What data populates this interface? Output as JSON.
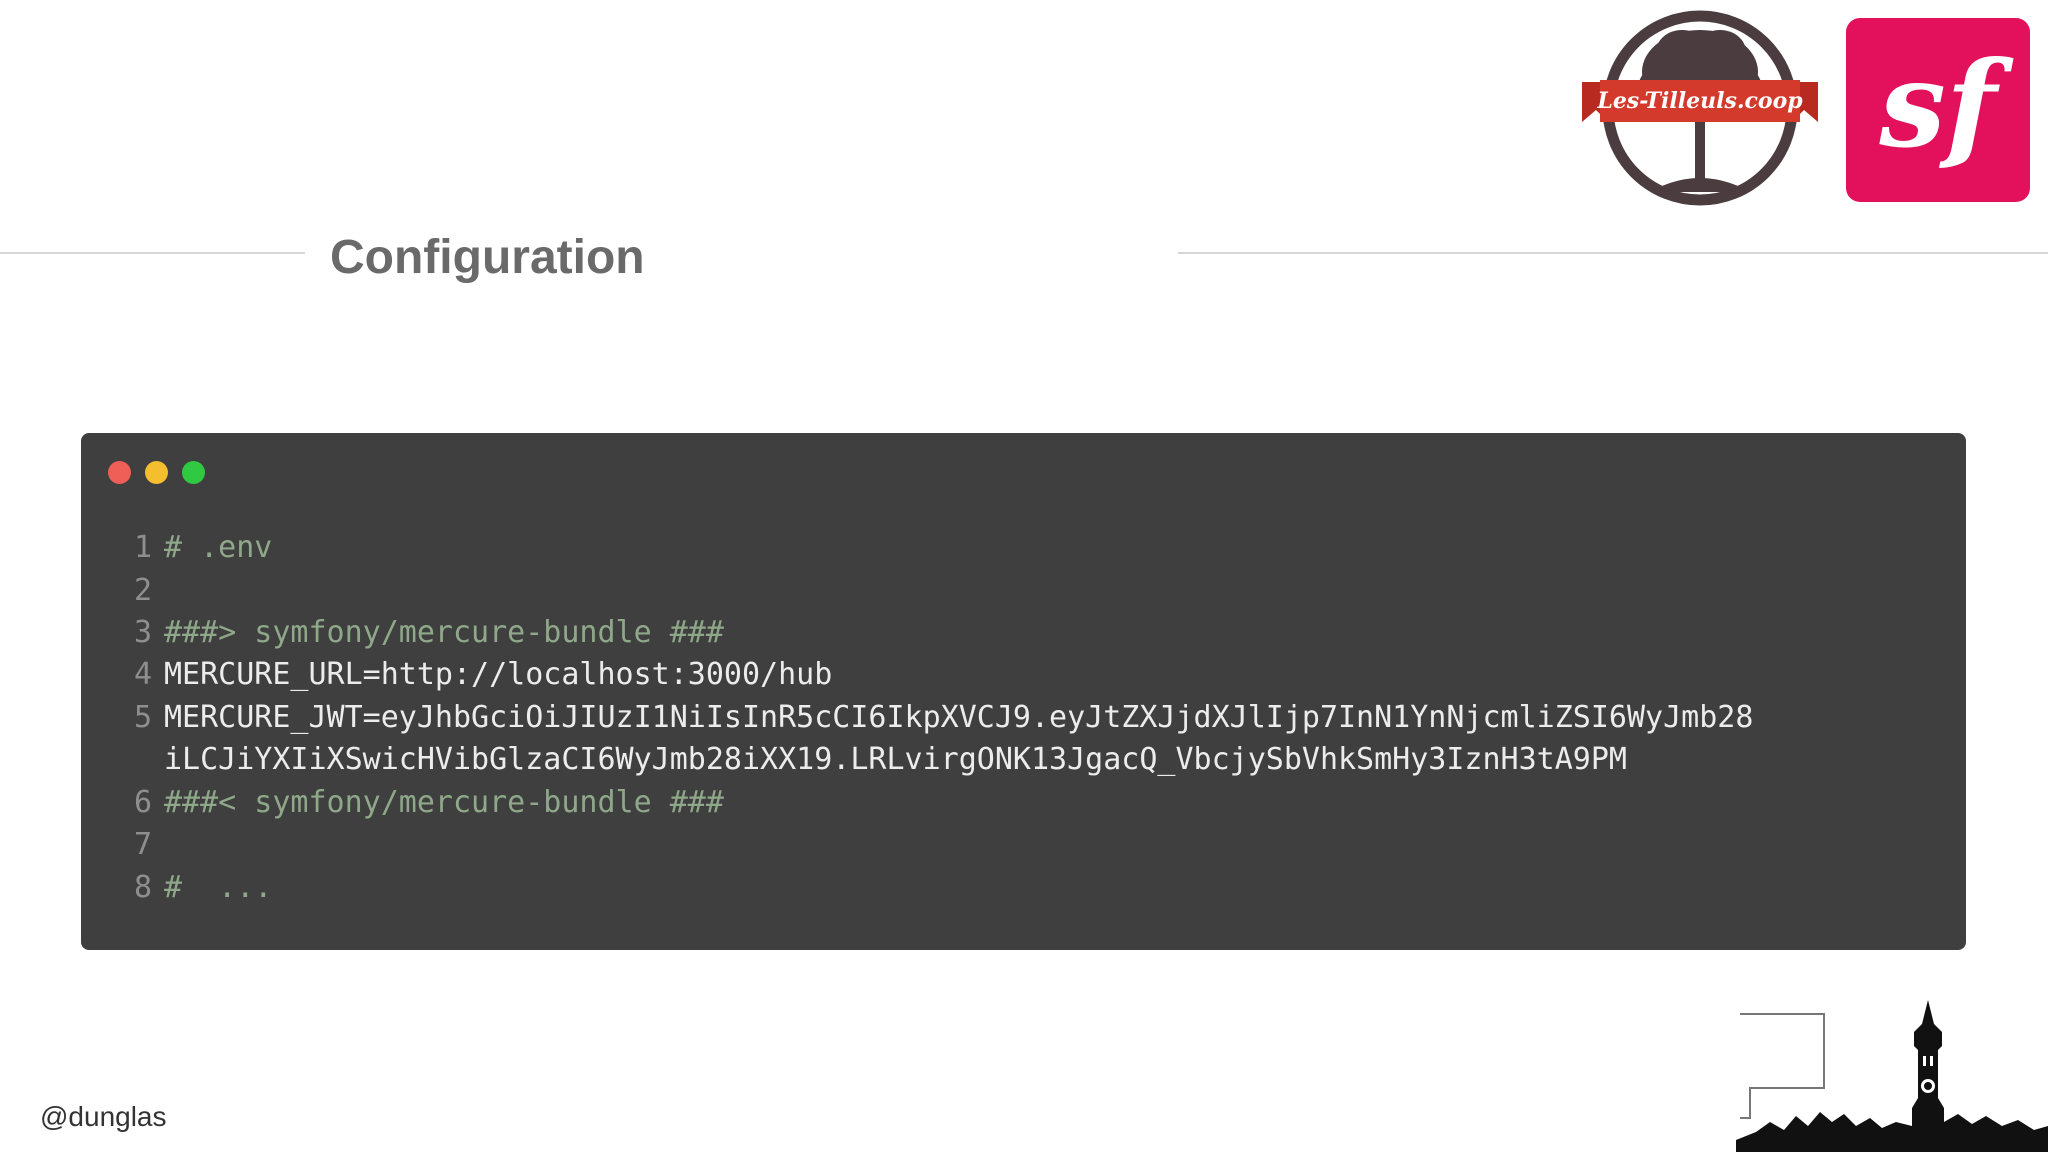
{
  "slide": {
    "title": "Configuration",
    "handle": "@dunglas"
  },
  "logos": {
    "tilleuls_text": "Les-Tilleuls.coop",
    "symfony_icon": "symfony-sf-icon"
  },
  "code_window": {
    "buttons": [
      "close",
      "minimize",
      "maximize"
    ],
    "colors": {
      "background": "#3f3f3f",
      "close": "#f05f57",
      "minimize": "#f4be2f",
      "maximize": "#2fca41",
      "comment": "#8fa88a",
      "text": "#ececec"
    },
    "lines": [
      {
        "num": "1",
        "text": "# .env",
        "kind": "comment"
      },
      {
        "num": "2",
        "text": "",
        "kind": "plain"
      },
      {
        "num": "3",
        "text": "###> symfony/mercure-bundle ###",
        "kind": "comment"
      },
      {
        "num": "4",
        "text": "MERCURE_URL=http://localhost:3000/hub",
        "kind": "plain"
      },
      {
        "num": "5",
        "text": "MERCURE_JWT=eyJhbGciOiJIUzI1NiIsInR5cCI6IkpXVCJ9.eyJtZXJjdXJlIjp7InN1YnNjcmliZSI6WyJmb28",
        "kind": "plain"
      },
      {
        "num": "",
        "text": "iLCJiYXIiXSwicHVibGlzaCI6WyJmb28iXX19.LRLvirgONK13JgacQ_VbcjySbVhkSmHy3IznH3tA9PM",
        "kind": "plain"
      },
      {
        "num": "6",
        "text": "###< symfony/mercure-bundle ###",
        "kind": "comment"
      },
      {
        "num": "7",
        "text": "",
        "kind": "plain"
      },
      {
        "num": "8",
        "text": "#  ...",
        "kind": "comment"
      }
    ]
  }
}
